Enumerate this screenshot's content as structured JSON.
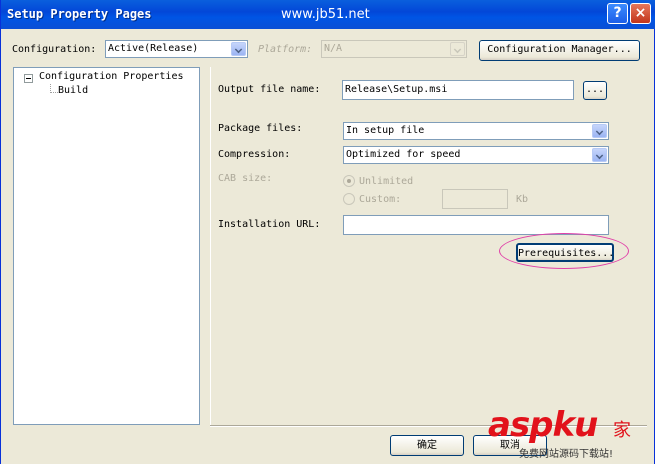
{
  "window": {
    "title": "Setup Property Pages",
    "watermark_url": "www.jb51.net",
    "help_button": "?",
    "close_button": "×"
  },
  "top": {
    "configuration_label": "Configuration:",
    "configuration_value": "Active(Release)",
    "platform_label": "Platform:",
    "platform_value": "N/A",
    "configuration_manager_button": "Configuration Manager..."
  },
  "tree": {
    "root_label": "Configuration Properties",
    "child_label": "Build"
  },
  "form": {
    "output_file_label": "Output file name:",
    "output_file_value": "Release\\Setup.msi",
    "browse_button": "...",
    "package_files_label": "Package files:",
    "package_files_value": "In setup file",
    "compression_label": "Compression:",
    "compression_value": "Optimized for speed",
    "cab_size_label": "CAB size:",
    "unlimited_label": "Unlimited",
    "custom_label": "Custom:",
    "custom_value": "",
    "kb_label": "Kb",
    "installation_url_label": "Installation URL:",
    "installation_url_value": "",
    "prerequisites_button": "Prerequisites..."
  },
  "footer": {
    "ok_button": "确定",
    "cancel_button": "取消"
  },
  "watermark": {
    "logo_text": "aspku",
    "logo_suffix": "家",
    "logo_subtext": "免费网站源码下载站!"
  }
}
